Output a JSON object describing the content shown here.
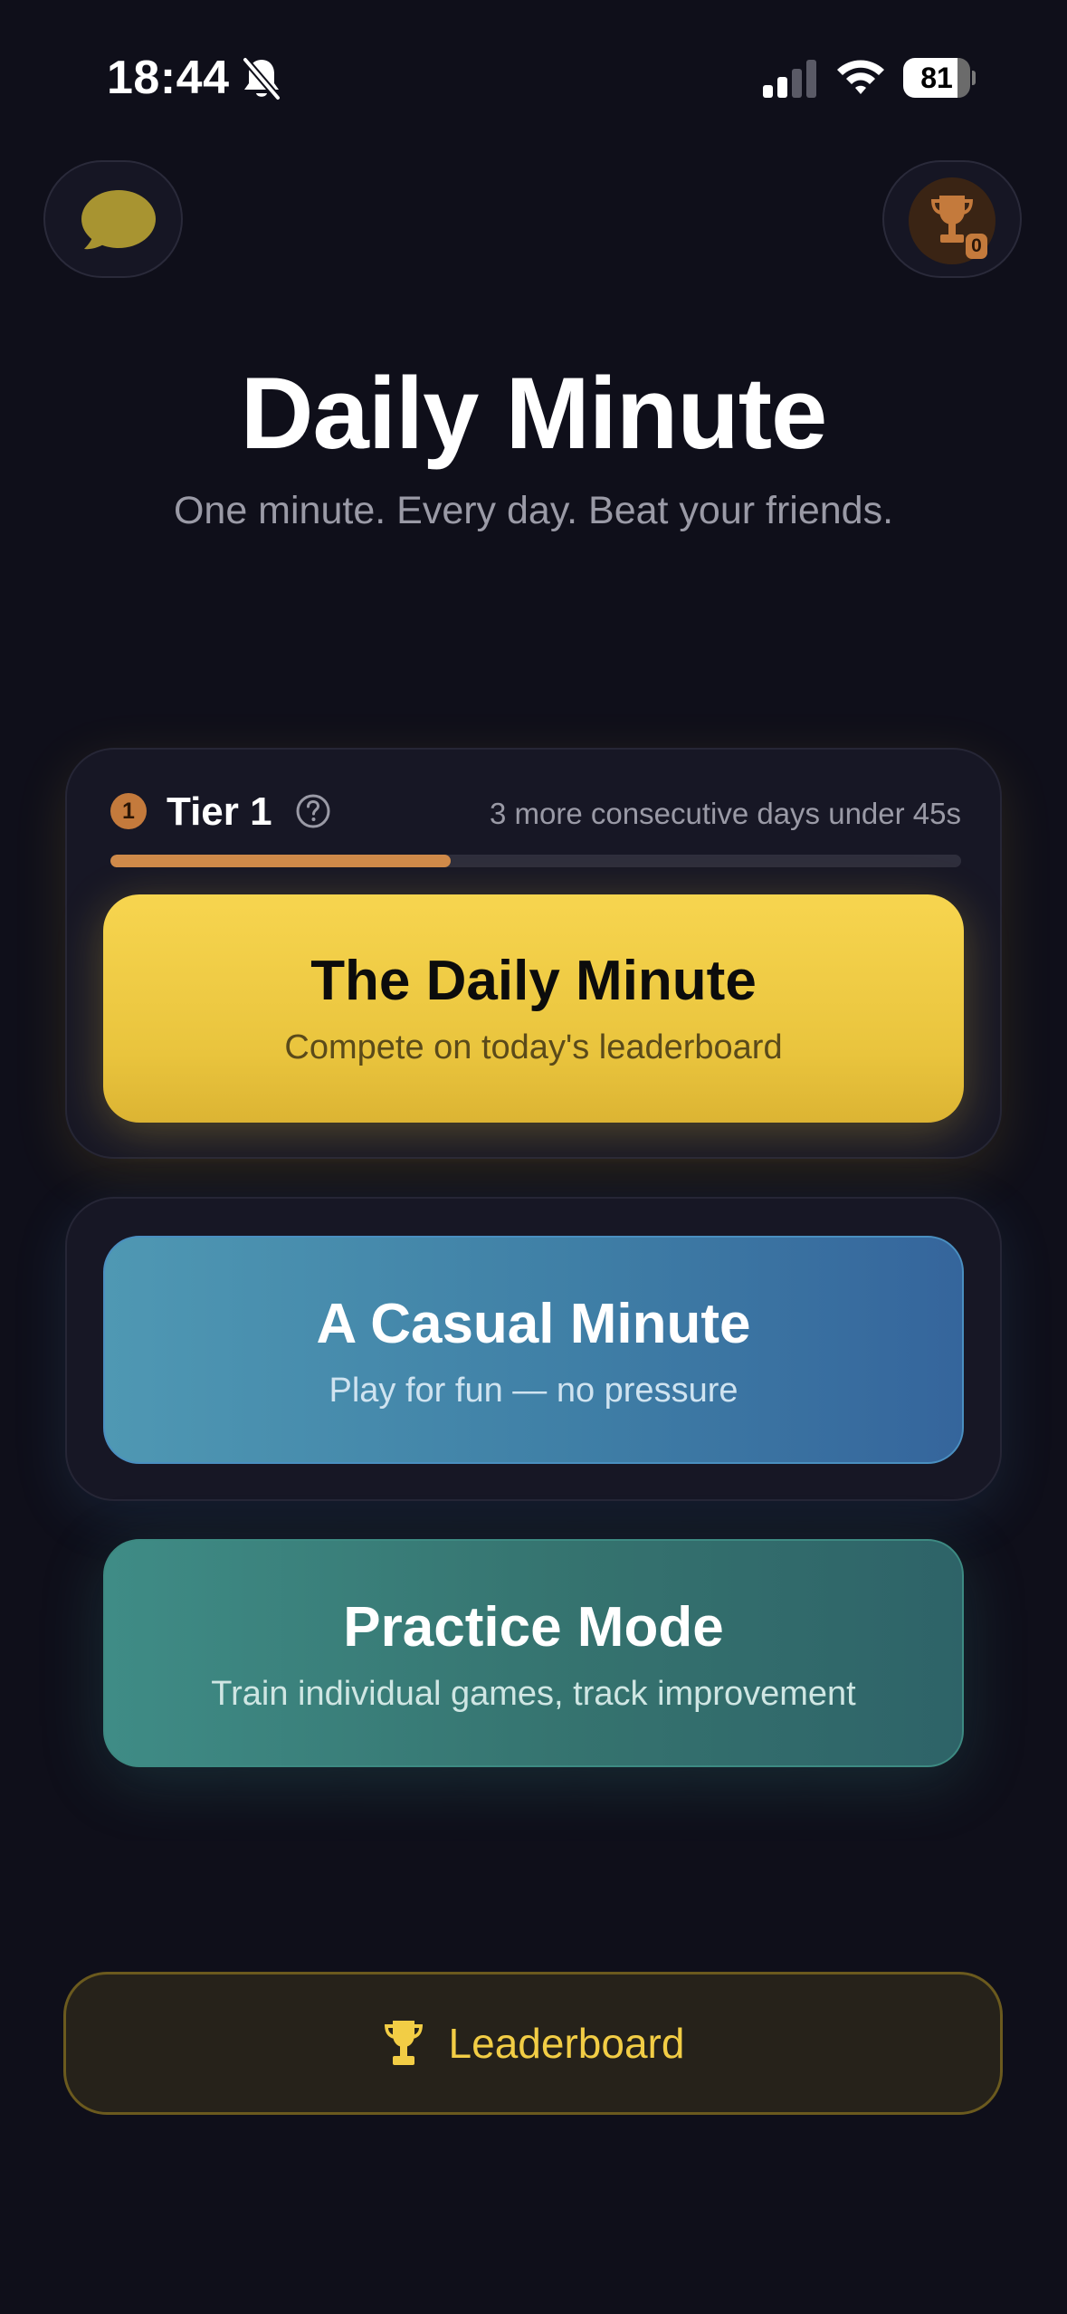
{
  "status_bar": {
    "time": "18:44",
    "battery_level": "81"
  },
  "header": {
    "trophy_count": "0"
  },
  "hero": {
    "title": "Daily Minute",
    "subtitle": "One minute. Every day. Beat your friends."
  },
  "tier": {
    "badge": "1",
    "label": "Tier 1",
    "progress_text": "3 more consecutive days under 45s",
    "progress_fraction": 0.4,
    "color": "#cf8a4a"
  },
  "modes": {
    "daily": {
      "title": "The Daily Minute",
      "subtitle": "Compete on today's leaderboard",
      "color": "#f2d048"
    },
    "casual": {
      "title": "A Casual Minute",
      "subtitle": "Play for fun — no pressure",
      "color": "#4686ad"
    },
    "practice": {
      "title": "Practice Mode",
      "subtitle": "Train individual games, track improvement",
      "color": "#377a77"
    }
  },
  "leaderboard": {
    "label": "Leaderboard",
    "color": "#f2cd45"
  },
  "icons": {
    "notifications": "bell-slash-icon",
    "chat": "chat-bubble-icon",
    "trophy": "trophy-icon",
    "help": "question-circle-icon"
  }
}
